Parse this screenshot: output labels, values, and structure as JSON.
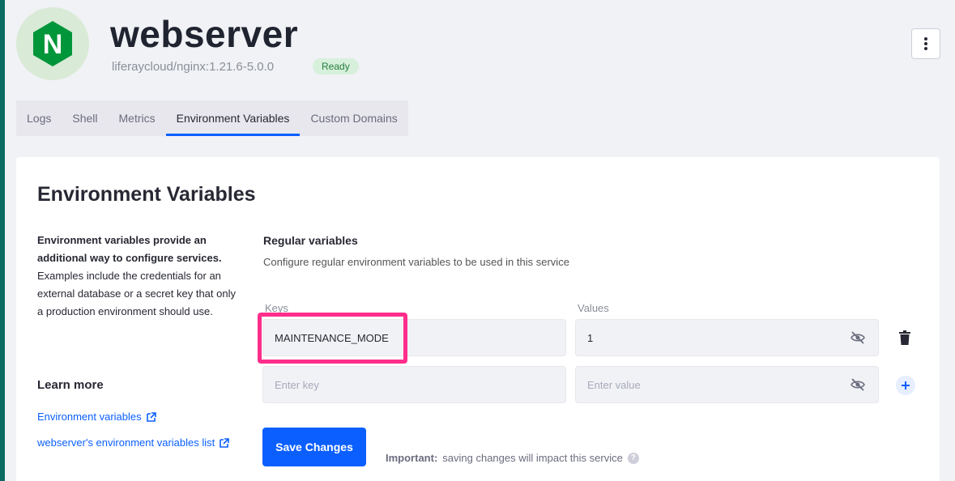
{
  "header": {
    "title": "webserver",
    "image": "liferaycloud/nginx:1.21.6-5.0.0",
    "status": "Ready",
    "logo_letter": "N"
  },
  "tabs": [
    {
      "label": "Logs"
    },
    {
      "label": "Shell"
    },
    {
      "label": "Metrics"
    },
    {
      "label": "Environment Variables",
      "active": true
    },
    {
      "label": "Custom Domains"
    }
  ],
  "card": {
    "title": "Environment Variables",
    "description_strong": "Environment variables provide an additional way to configure services.",
    "description_rest": "Examples include the credentials for an external database or a secret key that only a production environment should use.",
    "learn_more": "Learn more",
    "links": [
      {
        "label": "Environment variables"
      },
      {
        "label": "webserver's environment variables list"
      }
    ]
  },
  "regular": {
    "title": "Regular variables",
    "subtitle": "Configure regular environment variables to be used in this service",
    "keys_label": "Keys",
    "values_label": "Values",
    "rows": [
      {
        "key": "MAINTENANCE_MODE",
        "value": "1"
      }
    ],
    "key_placeholder": "Enter key",
    "value_placeholder": "Enter value"
  },
  "footer": {
    "save_label": "Save Changes",
    "important_label": "Important:",
    "important_text": "saving changes will impact this service",
    "help_glyph": "?"
  },
  "icons": [
    "nginx-logo",
    "kebab-icon",
    "eye-slash-icon",
    "trash-icon",
    "plus-icon",
    "external-link-icon",
    "help-icon"
  ],
  "colors": {
    "accent": "#0b5fff",
    "highlight": "#ff2d8b",
    "ready": "#287d3c"
  }
}
